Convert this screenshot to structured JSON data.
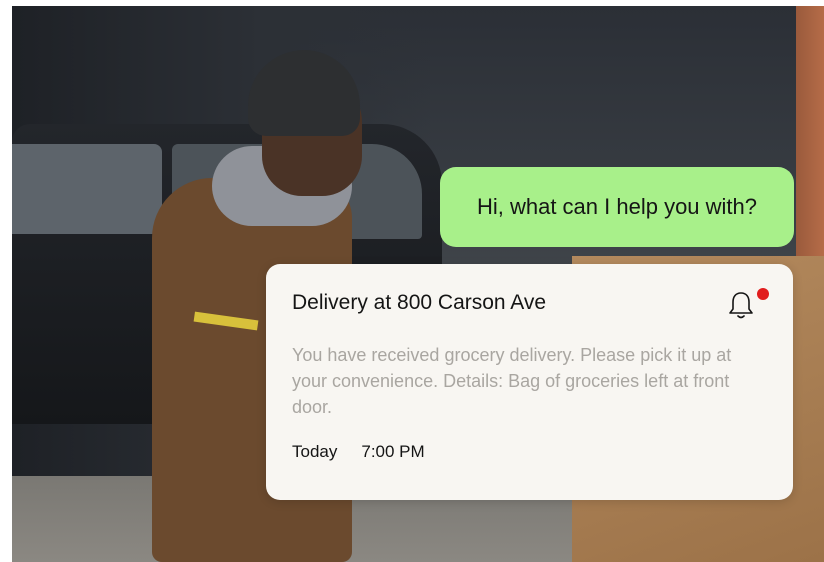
{
  "chat": {
    "message": "Hi, what can I help you with?",
    "bubble_color": "#a8f08a"
  },
  "notification": {
    "title": "Delivery at 800 Carson Ave",
    "body": "You have received grocery delivery. Please pick it up at your convenience. Details: Bag of groceries left at front door.",
    "date": "Today",
    "time": "7:00 PM",
    "icon": "bell-icon",
    "unread_dot_color": "#e11d1d"
  }
}
